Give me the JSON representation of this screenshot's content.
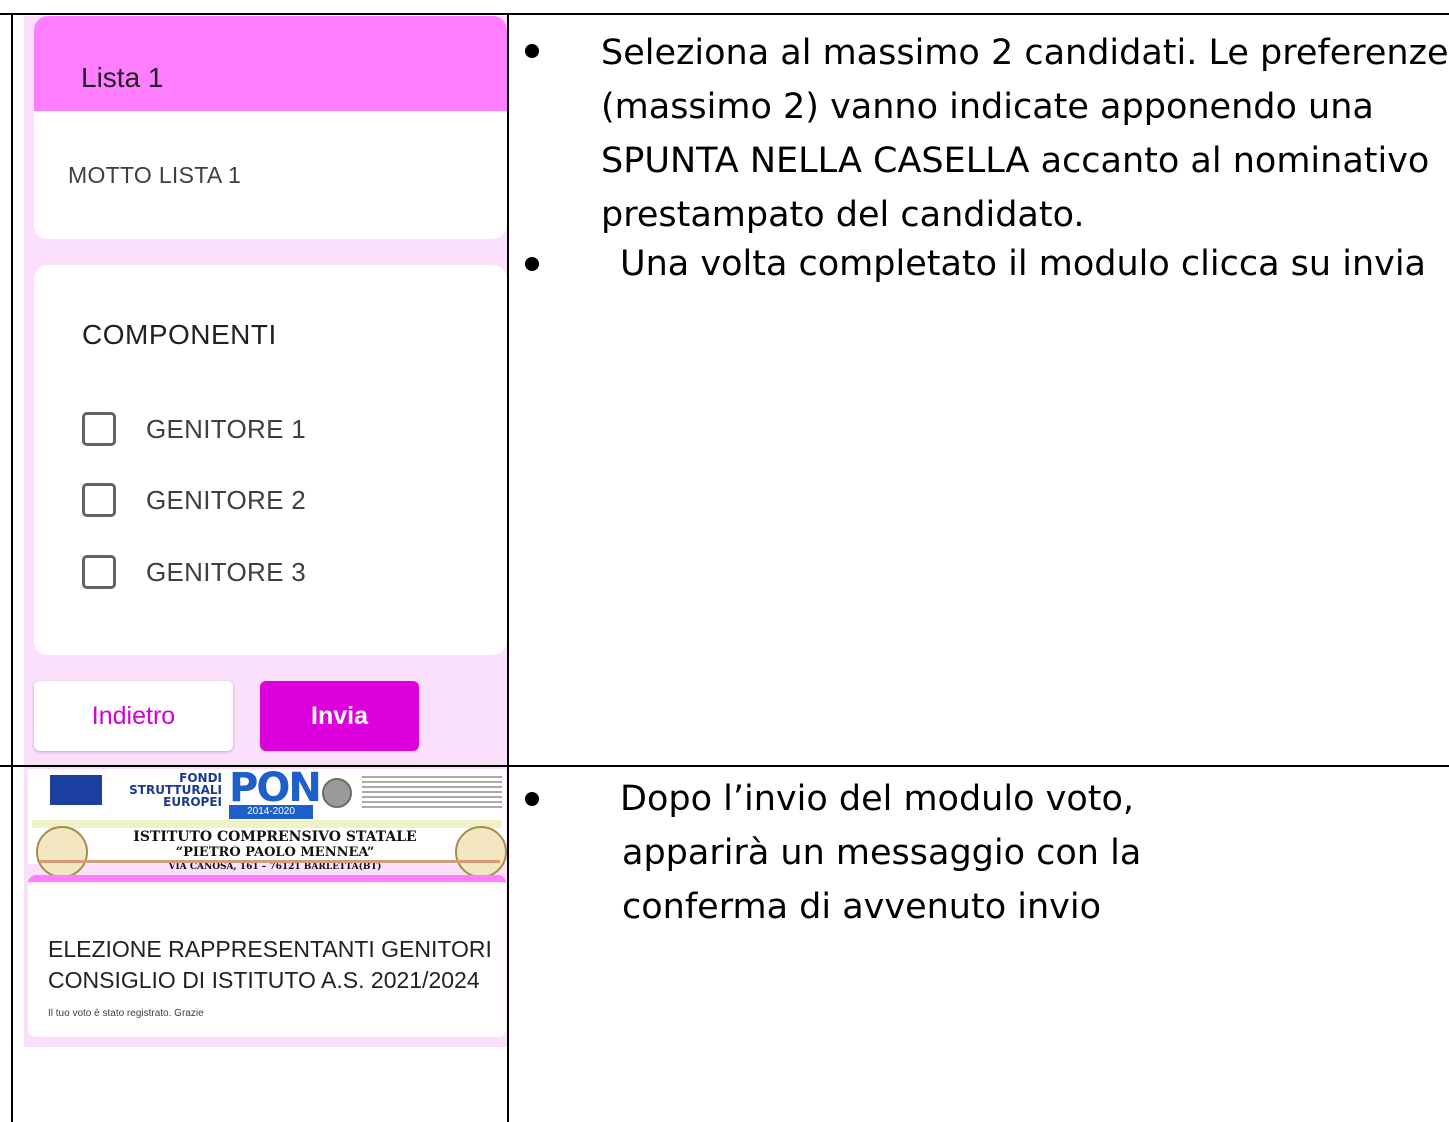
{
  "form": {
    "section_title": "Lista 1",
    "motto": "MOTTO LISTA 1",
    "components_title": "COMPONENTI",
    "options": [
      "GENITORE 1",
      "GENITORE 2",
      "GENITORE 3"
    ],
    "back_button": "Indietro",
    "submit_button": "Invia"
  },
  "instructions": {
    "bullet1_lines": [
      "Seleziona al massimo 2 candidati. Le preferenze",
      "(massimo 2) vanno indicate apponendo una",
      "SPUNTA NELLA CASELLA accanto al nominativo",
      "prestampato del candidato."
    ],
    "bullet2": "Una volta completato il modulo clicca su invia",
    "bullet3_lines": [
      "Dopo l’invio del modulo voto,",
      "apparirà un messaggio con la",
      "conferma di avvenuto invio"
    ]
  },
  "confirmation": {
    "logos": {
      "fondi_lines": [
        "FONDI",
        "STRUTTURALI",
        "EUROPEI"
      ],
      "pon": "PON",
      "pon_years": "2014-2020"
    },
    "school_name": "ISTITUTO COMPRENSIVO STATALE",
    "school_subtitle": "“PIETRO PAOLO MENNEA”",
    "school_address": "VIA CANOSA, 161 – 76121 BARLETTA(BT)",
    "title_lines": [
      "ELEZIONE RAPPRESENTANTI GENITORI",
      "CONSIGLIO DI ISTITUTO A.S. 2021/2024"
    ],
    "message": "Il tuo voto è stato registrato. Grazie"
  },
  "colors": {
    "accent": "#ff7eff",
    "submit": "#dd00dd",
    "back_text": "#d500d5",
    "form_background": "#fbe0fb"
  }
}
